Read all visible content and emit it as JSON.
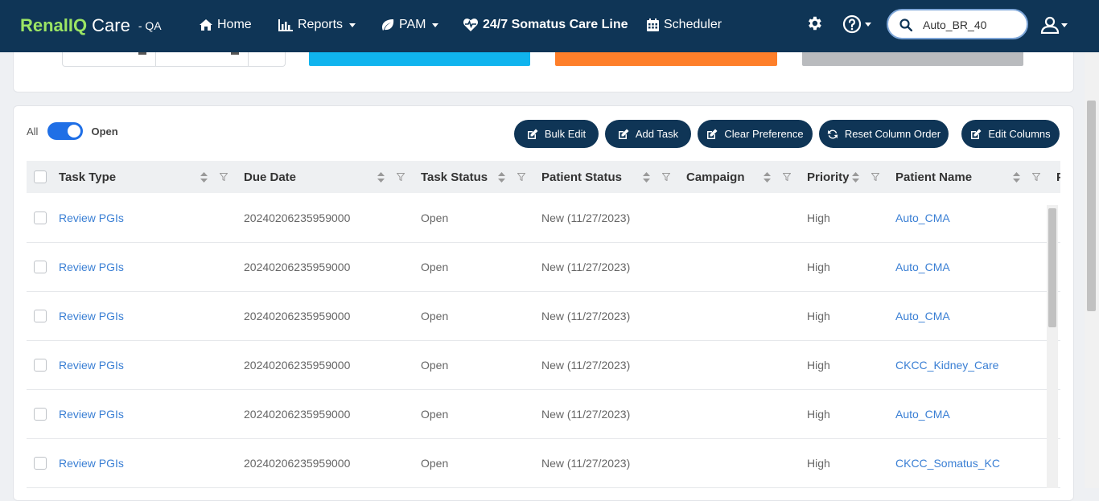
{
  "brand": {
    "name_part1": "Renal",
    "name_part2": "IQ",
    "name_part3": "Care",
    "env": "- QA"
  },
  "nav": {
    "home": "Home",
    "reports": "Reports",
    "pam": "PAM",
    "care_line": "24/7 Somatus Care Line",
    "scheduler": "Scheduler"
  },
  "search": {
    "value": "Auto_BR_40",
    "icon": "search-icon"
  },
  "toggle": {
    "left_label": "All",
    "right_label": "Open",
    "state": "Open"
  },
  "actions": {
    "bulk_edit": "Bulk Edit",
    "add_task": "Add Task",
    "clear_preference": "Clear Preference",
    "reset_column_order": "Reset Column Order",
    "edit_columns": "Edit Columns"
  },
  "table": {
    "columns": [
      "Task Type",
      "Due Date",
      "Task Status",
      "Patient Status",
      "Campaign",
      "Priority",
      "Patient Name",
      "P"
    ],
    "rows": [
      {
        "task_type": "Review PGIs",
        "due_date": "20240206235959000",
        "task_status": "Open",
        "patient_status": "New (11/27/2023)",
        "campaign": "",
        "priority": "High",
        "patient_name": "Auto_CMA"
      },
      {
        "task_type": "Review PGIs",
        "due_date": "20240206235959000",
        "task_status": "Open",
        "patient_status": "New (11/27/2023)",
        "campaign": "",
        "priority": "High",
        "patient_name": "Auto_CMA"
      },
      {
        "task_type": "Review PGIs",
        "due_date": "20240206235959000",
        "task_status": "Open",
        "patient_status": "New (11/27/2023)",
        "campaign": "",
        "priority": "High",
        "patient_name": "Auto_CMA"
      },
      {
        "task_type": "Review PGIs",
        "due_date": "20240206235959000",
        "task_status": "Open",
        "patient_status": "New (11/27/2023)",
        "campaign": "",
        "priority": "High",
        "patient_name": "CKCC_Kidney_Care"
      },
      {
        "task_type": "Review PGIs",
        "due_date": "20240206235959000",
        "task_status": "Open",
        "patient_status": "New (11/27/2023)",
        "campaign": "",
        "priority": "High",
        "patient_name": "Auto_CMA"
      },
      {
        "task_type": "Review PGIs",
        "due_date": "20240206235959000",
        "task_status": "Open",
        "patient_status": "New (11/27/2023)",
        "campaign": "",
        "priority": "High",
        "patient_name": "CKCC_Somatus_KC"
      }
    ]
  },
  "colors": {
    "navbar": "#0f3556",
    "brand_accent": "#9be564",
    "link": "#3a7fd4",
    "toggle": "#1f6fe6",
    "tile_blue": "#10b4ee",
    "tile_orange": "#fe7f2a",
    "tile_gray": "#b9bbbe"
  }
}
